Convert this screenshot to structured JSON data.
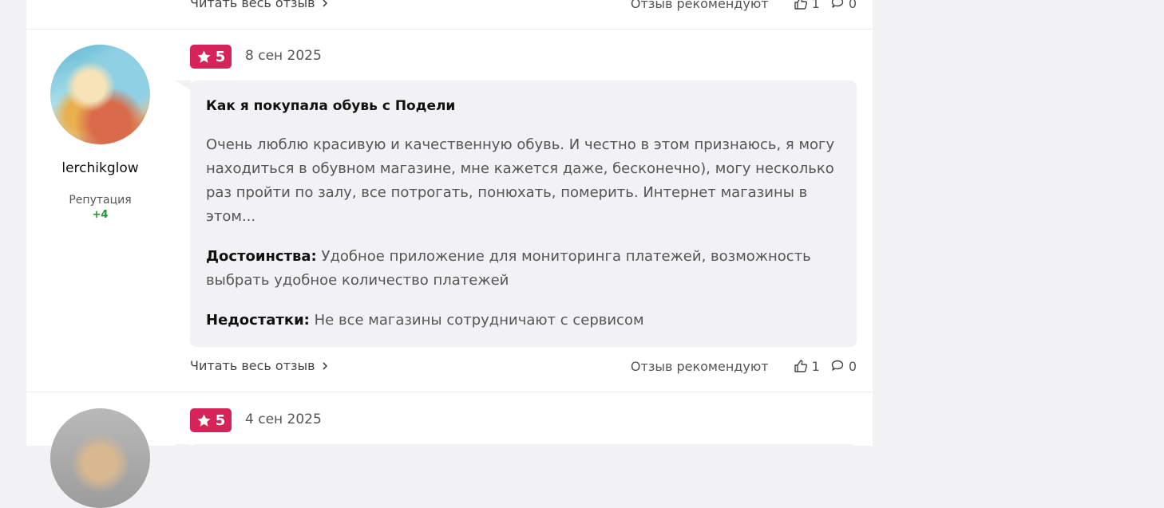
{
  "prev_review": {
    "read_more": "Читать весь отзыв",
    "recommend_label": "Отзыв рекомендуют",
    "likes": "1",
    "comments": "0"
  },
  "review": {
    "author": "lerchikglow",
    "reputation_label": "Репутация",
    "reputation_value": "+4",
    "rating": "5",
    "date": "8 сен 2025",
    "title": "Как я покупала обувь с Подели",
    "text": "Очень люблю красивую и качественную обувь. И честно в этом признаюсь, я могу находиться в обувном магазине, мне кажется даже, бесконечно), могу несколько раз пройти по залу, все потрогать, понюхать, померить. Интернет магазины в этом...",
    "pros_label": "Достоинства:",
    "pros": "Удобное приложение для мониторинга платежей, возможность выбрать удобное количество платежей",
    "cons_label": "Недостатки:",
    "cons": "Не все магазины сотрудничают с сервисом",
    "read_more": "Читать весь отзыв",
    "recommend_label": "Отзыв рекомендуют",
    "likes": "1",
    "comments": "0"
  },
  "next_review": {
    "rating": "5",
    "date": "4 сен 2025"
  },
  "colors": {
    "rating_badge": "#d6245a",
    "reputation_positive": "#1a9b2c"
  }
}
